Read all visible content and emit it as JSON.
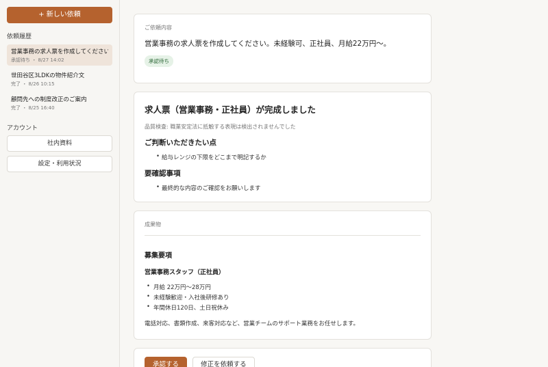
{
  "sidebar": {
    "new_button": "+ 新しい依頼",
    "history_label": "依頼履歴",
    "history": [
      {
        "title": "営業事務の求人票を作成してください",
        "status": "承認待ち",
        "date": "8/27 14:02"
      },
      {
        "title": "世田谷区3LDKの物件紹介文",
        "status": "完了",
        "date": "8/26 10:15"
      },
      {
        "title": "顧問先への制度改正のご案内",
        "status": "完了",
        "date": "8/25 16:40"
      }
    ],
    "meta_separator": "・",
    "account_label": "アカウント",
    "account_buttons": [
      "社内資料",
      "設定・利用状況"
    ]
  },
  "request": {
    "label": "ご依頼内容",
    "text": "営業事務の求人票を作成してください。未経験可、正社員、月給22万円〜。",
    "badge": "承認待ち"
  },
  "result": {
    "title": "求人票（営業事務・正社員）が完成しました",
    "quality_check": "品質検査: 職業安定法に抵触する表現は検出されませんでした",
    "decision_heading": "ご判断いただきたい点",
    "decision_items": [
      "給与レンジの下限をどこまで明記するか"
    ],
    "confirm_heading": "要確認事項",
    "confirm_items": [
      "最終的な内容のご確認をお願いします"
    ]
  },
  "deliverable": {
    "label": "成果物",
    "heading": "募集要項",
    "subheading": "営業事務スタッフ（正社員）",
    "items": [
      "月給 22万円〜28万円",
      "未経験歓迎・入社後研修あり",
      "年間休日120日、土日祝休み"
    ],
    "paragraph": "電話対応、書類作成、来客対応など、営業チームのサポート業務をお任せします。"
  },
  "actions": {
    "approve": "承認する",
    "revise": "修正を依頼する"
  },
  "colors": {
    "accent": "#b5622e",
    "badge_bg": "#e6f2e7",
    "badge_text": "#2f6a3a",
    "active_item_bg": "#efe4da"
  }
}
